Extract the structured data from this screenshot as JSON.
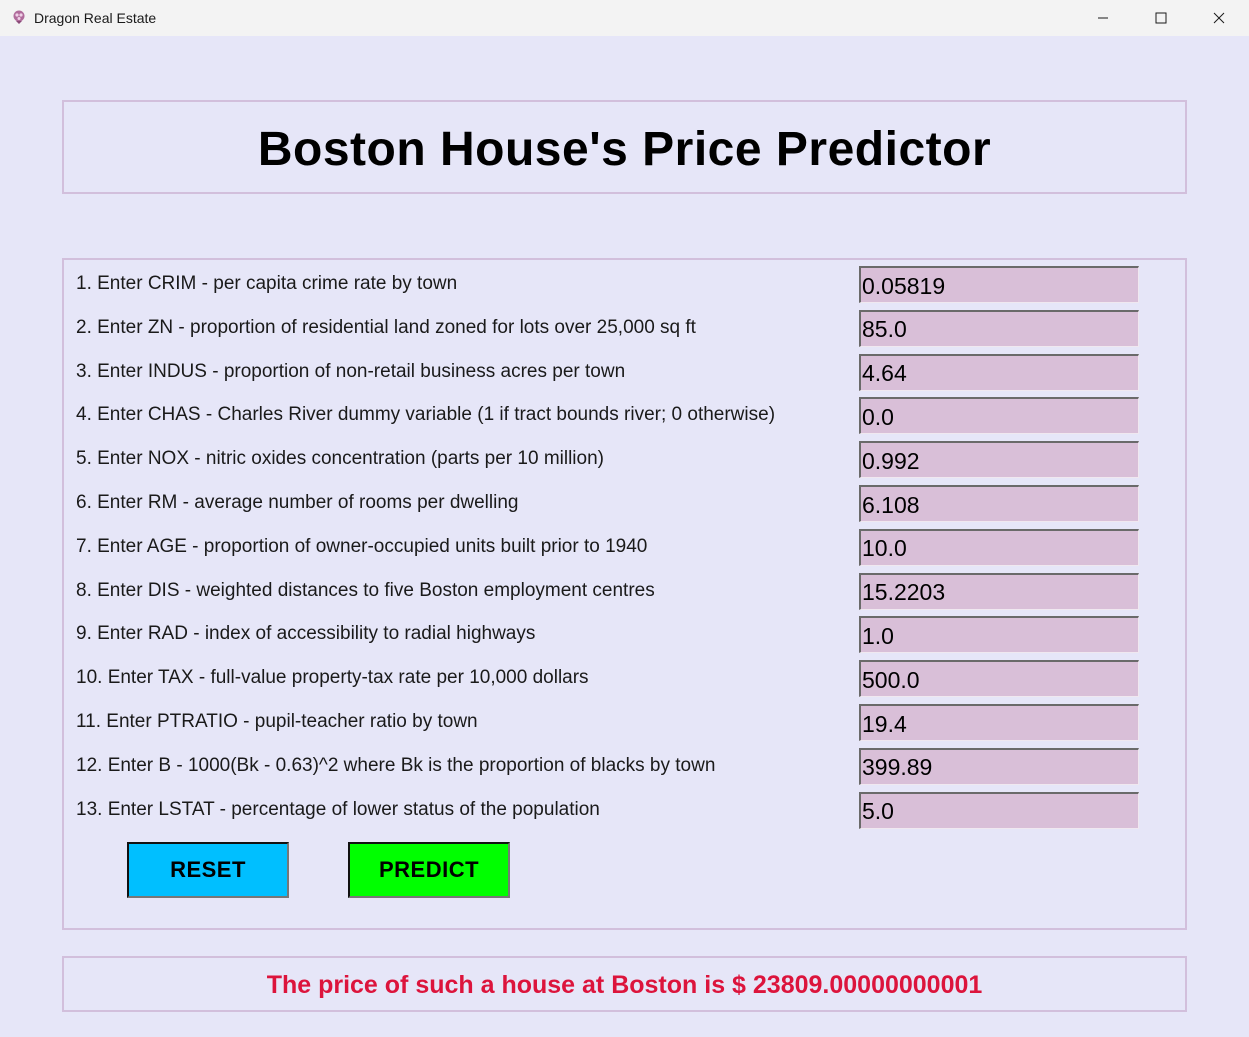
{
  "window": {
    "title": "Dragon Real Estate"
  },
  "header": {
    "title": "Boston House's Price Predictor"
  },
  "form": {
    "rows": [
      {
        "label": "1. Enter CRIM - per capita crime rate by town",
        "value": "0.05819"
      },
      {
        "label": "2. Enter ZN - proportion of residential land zoned for lots over 25,000 sq ft",
        "value": "85.0"
      },
      {
        "label": "3. Enter INDUS - proportion of non-retail business acres per town",
        "value": "4.64"
      },
      {
        "label": "4. Enter CHAS - Charles River dummy variable (1 if tract bounds river; 0 otherwise)",
        "value": "0.0"
      },
      {
        "label": "5. Enter NOX - nitric oxides concentration (parts per 10 million)",
        "value": "0.992"
      },
      {
        "label": "6. Enter RM - average number of rooms per dwelling",
        "value": "6.108"
      },
      {
        "label": "7. Enter AGE - proportion of owner-occupied units built prior to 1940",
        "value": "10.0"
      },
      {
        "label": "8. Enter DIS - weighted distances to five Boston employment centres",
        "value": "15.2203"
      },
      {
        "label": "9. Enter RAD - index of accessibility to radial highways",
        "value": "1.0"
      },
      {
        "label": "10. Enter TAX - full-value property-tax rate per 10,000 dollars",
        "value": "500.0"
      },
      {
        "label": "11. Enter PTRATIO - pupil-teacher ratio by town",
        "value": "19.4"
      },
      {
        "label": "12. Enter B - 1000(Bk - 0.63)^2 where Bk is the proportion of blacks by town",
        "value": "399.89"
      },
      {
        "label": "13. Enter LSTAT - percentage of lower status of the population",
        "value": "5.0"
      }
    ],
    "reset_label": "RESET",
    "predict_label": "PREDICT"
  },
  "result": {
    "text": "The price of such a house at Boston is $ 23809.00000000001"
  },
  "colors": {
    "background": "#e6e6f8",
    "panel_border": "#d2bfdc",
    "input_bg": "#d9bfd8",
    "reset_bg": "#00bfff",
    "predict_bg": "#00ff00",
    "result_text": "#dc143c"
  },
  "icons": {
    "app": "dragon-app-icon",
    "minimize": "minimize-icon",
    "maximize": "maximize-icon",
    "close": "close-icon"
  }
}
